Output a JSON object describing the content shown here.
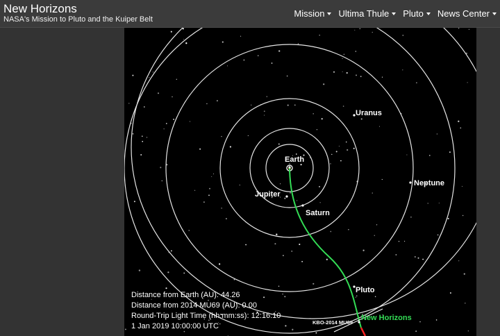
{
  "header": {
    "title": "New Horizons",
    "subtitle": "NASA's Mission to Pluto and the Kuiper Belt"
  },
  "nav": {
    "items": [
      {
        "label": "Mission"
      },
      {
        "label": "Ultima Thule"
      },
      {
        "label": "Pluto"
      },
      {
        "label": "News Center"
      }
    ]
  },
  "orbit_view": {
    "planets": {
      "earth": "Earth",
      "jupiter": "Jupiter",
      "saturn": "Saturn",
      "uranus": "Uranus",
      "neptune": "Neptune",
      "pluto": "Pluto"
    },
    "spacecraft_label": "New Horizons",
    "target_label": "KBO-2014 MU69",
    "colors": {
      "trajectory": "#33dd55",
      "post_flyby": "#ff2222",
      "orbit": "#e6e6e6",
      "label": "#ffffff"
    }
  },
  "readout": {
    "distance_earth": "Distance from Earth (AU): 44.26",
    "distance_mu69": "Distance from 2014 MU69 (AU): 0.00",
    "light_time": "Round-Trip Light Time (hh:mm:ss): 12:16:10",
    "datetime": "1 Jan 2019 10:00:00 UTC"
  }
}
